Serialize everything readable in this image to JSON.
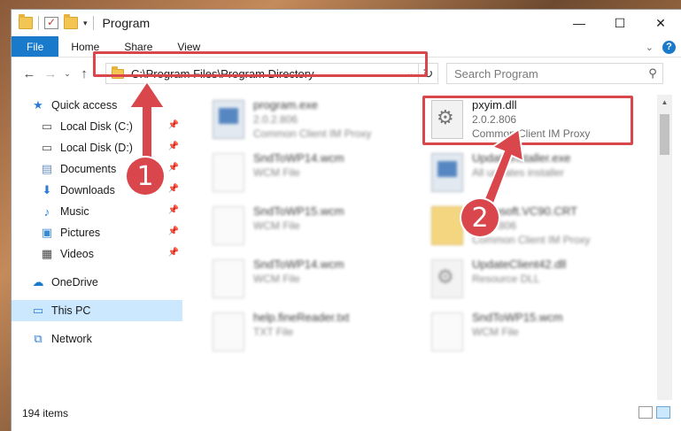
{
  "window": {
    "title": "Program",
    "minimize": "—",
    "maximize": "☐",
    "close": "✕"
  },
  "ribbon": {
    "tabs": [
      "File",
      "Home",
      "Share",
      "View"
    ],
    "help": "?"
  },
  "address": {
    "path": "C:\\Program Files\\Program Directory",
    "dropdown": "⌄",
    "refresh": "↻"
  },
  "search": {
    "placeholder": "Search Program"
  },
  "sidebar": {
    "items": [
      {
        "label": "Quick access",
        "icon": "star-icon"
      },
      {
        "label": "Local Disk (C:)",
        "icon": "drive-icon"
      },
      {
        "label": "Local Disk (D:)",
        "icon": "drive-icon"
      },
      {
        "label": "Documents",
        "icon": "documents-icon"
      },
      {
        "label": "Downloads",
        "icon": "downloads-icon"
      },
      {
        "label": "Music",
        "icon": "music-icon"
      },
      {
        "label": "Pictures",
        "icon": "pictures-icon"
      },
      {
        "label": "Videos",
        "icon": "videos-icon"
      },
      {
        "label": "OneDrive",
        "icon": "cloud-icon"
      },
      {
        "label": "This PC",
        "icon": "pc-icon"
      },
      {
        "label": "Network",
        "icon": "network-icon"
      }
    ]
  },
  "files": [
    {
      "name": "program.exe",
      "line2": "2.0.2.806",
      "line3": "Common Client IM Proxy"
    },
    {
      "name": "pxyim.dll",
      "line2": "2.0.2.806",
      "line3": "Common Client IM Proxy"
    },
    {
      "name": "SndToWP14.wcm",
      "line2": "WCM File",
      "line3": ""
    },
    {
      "name": "UpdateInstaller.exe",
      "line2": "All updates installer",
      "line3": ""
    },
    {
      "name": "SndToWP15.wcm",
      "line2": "WCM File",
      "line3": ""
    },
    {
      "name": "Microsoft.VC90.CRT",
      "line2": "2.0.2.806",
      "line3": "Common Client IM Proxy"
    },
    {
      "name": "SndToWP14.wcm",
      "line2": "WCM File",
      "line3": ""
    },
    {
      "name": "UpdateClient42.dll",
      "line2": "Resource DLL",
      "line3": ""
    },
    {
      "name": "help.fineReader.txt",
      "line2": "TXT File",
      "line3": ""
    },
    {
      "name": "SndToWP15.wcm",
      "line2": "WCM File",
      "line3": ""
    }
  ],
  "status": {
    "count": "194 items"
  },
  "callouts": [
    "1",
    "2"
  ],
  "colors": {
    "accent": "#1979ca",
    "highlight": "#d9464b",
    "selected": "#cce8ff"
  }
}
